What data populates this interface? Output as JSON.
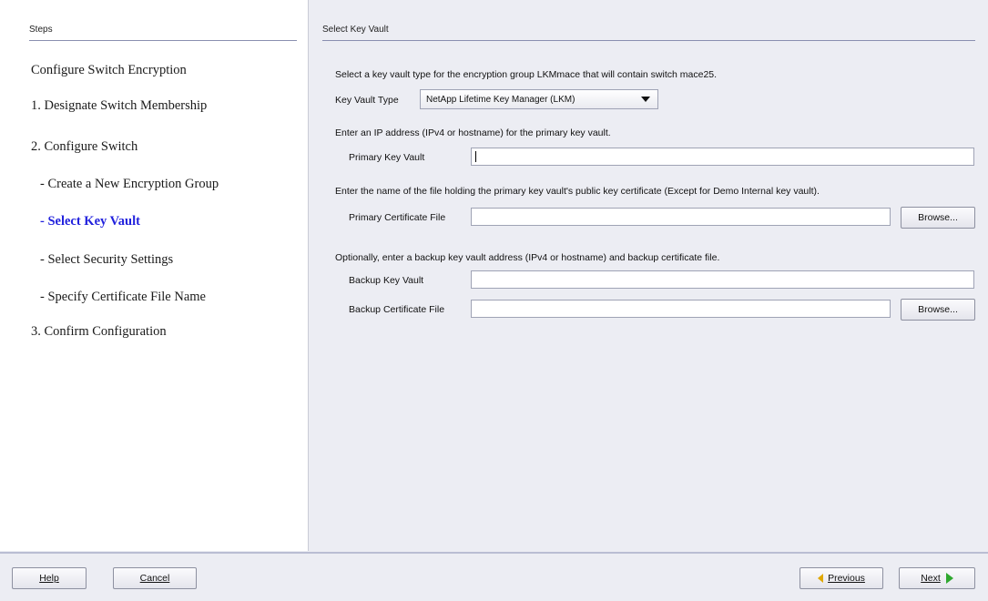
{
  "steps_panel": {
    "header": "Steps",
    "items": [
      {
        "label": "Configure Switch Encryption",
        "active": false
      },
      {
        "label": "1. Designate Switch Membership",
        "active": false
      },
      {
        "label": "2. Configure Switch",
        "active": false
      },
      {
        "label": "- Create a New Encryption Group",
        "active": false
      },
      {
        "label": "- Select Key Vault",
        "active": true
      },
      {
        "label": "- Select Security Settings",
        "active": false
      },
      {
        "label": "- Specify Certificate File Name",
        "active": false
      },
      {
        "label": "3. Confirm Configuration",
        "active": false
      }
    ]
  },
  "main": {
    "header": "Select Key Vault",
    "intro": "Select a key vault type for the encryption group LKMmace that will contain switch mace25.",
    "key_vault_type_label": "Key Vault Type",
    "key_vault_type_value": "NetApp Lifetime Key Manager (LKM)",
    "primary_instructions": "Enter an IP address (IPv4 or hostname) for the primary key vault.",
    "primary_key_vault_label": "Primary Key Vault",
    "primary_key_vault_value": "",
    "cert_instructions": "Enter the name of the file holding the primary key vault's public key certificate (Except for Demo Internal key vault).",
    "primary_cert_label": "Primary Certificate File",
    "primary_cert_value": "",
    "browse_label": "Browse...",
    "backup_instructions": "Optionally, enter a backup key vault address (IPv4 or hostname) and backup certificate file.",
    "backup_key_vault_label": "Backup Key Vault",
    "backup_key_vault_value": "",
    "backup_cert_label": "Backup Certificate File",
    "backup_cert_value": ""
  },
  "footer": {
    "help_label": "Help",
    "cancel_label": "Cancel",
    "previous_label": "Previous",
    "next_label": "Next"
  },
  "colors": {
    "active_step": "#2222dd",
    "previous_arrow": "#e0a800",
    "next_arrow": "#2fa82f"
  }
}
